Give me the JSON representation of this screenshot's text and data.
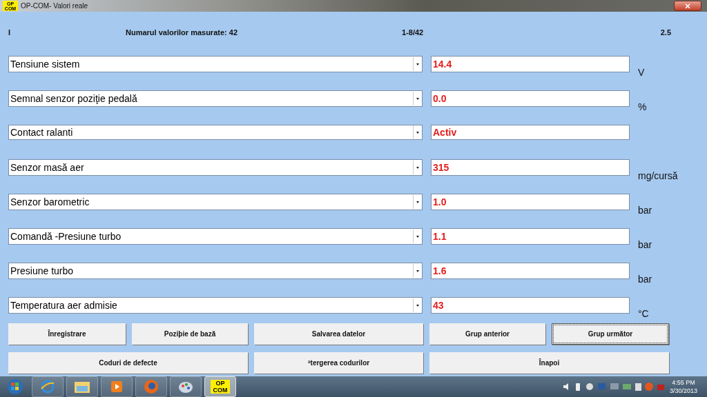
{
  "window": {
    "title": "OP-COM- Valori reale",
    "app_badge": "OP COM"
  },
  "header": {
    "marker": "I",
    "count_label": "Numarul valorilor masurate: 42",
    "range": "1-8/42",
    "version": "2.5"
  },
  "rows": [
    {
      "name": "Tensiune sistem",
      "value": "14.4",
      "unit": "V"
    },
    {
      "name": "Semnal senzor poziţie pedală",
      "value": "0.0",
      "unit": "%"
    },
    {
      "name": "Contact ralanti",
      "value": "Activ"
    },
    {
      "name": "Senzor masă aer",
      "value": "315",
      "unit": "mg/cursă"
    },
    {
      "name": "Senzor barometric",
      "value": "1.0",
      "unit": "bar"
    },
    {
      "name": "Comandă -Presiune turbo",
      "value": "1.1",
      "unit": "bar"
    },
    {
      "name": "Presiune turbo",
      "value": "1.6",
      "unit": "bar"
    },
    {
      "name": "Temperatura aer admisie",
      "value": "43",
      "unit": "°C"
    }
  ],
  "button_rows": [
    [
      {
        "label": "Înregistrare",
        "focused": false
      },
      {
        "label": "Poziþie de bază",
        "focused": false
      },
      {
        "label": "Salvarea datelor",
        "focused": false
      },
      {
        "label": "Grup anterior",
        "focused": false
      },
      {
        "label": "Grup următor",
        "focused": true
      }
    ],
    [
      {
        "label": "Coduri de defecte",
        "focused": false
      },
      {
        "label": "ªtergerea codurilor",
        "focused": false
      },
      {
        "label": "Înapoi",
        "focused": false
      }
    ]
  ],
  "taskbar": {
    "apps": [
      {
        "kind": "start",
        "selected": false
      },
      {
        "kind": "browser",
        "selected": false
      },
      {
        "kind": "folder",
        "selected": false
      },
      {
        "kind": "media",
        "selected": false
      },
      {
        "kind": "firefox",
        "selected": false
      },
      {
        "kind": "paint",
        "selected": false
      },
      {
        "kind": "opcom",
        "label": "OP COM",
        "selected": true
      }
    ],
    "time": "4:55 PM",
    "date": "3/30/2013"
  }
}
